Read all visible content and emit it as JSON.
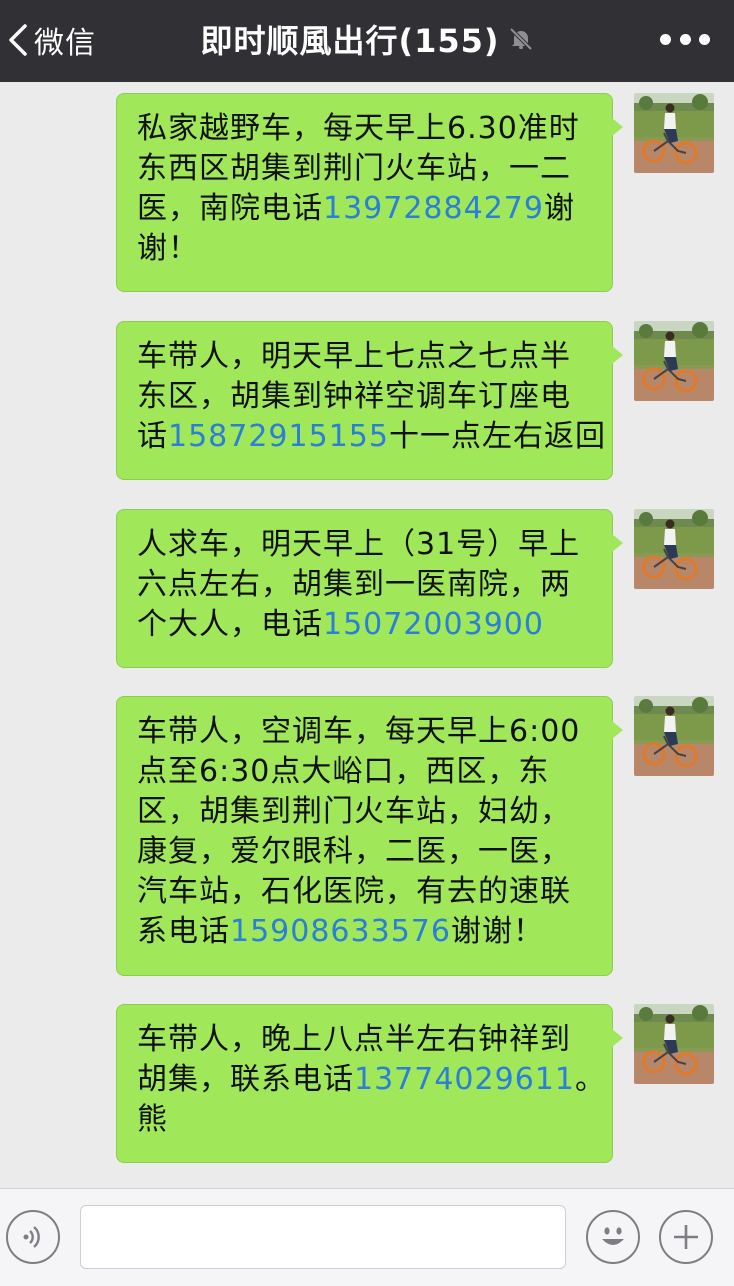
{
  "header": {
    "back_label": "微信",
    "title": "即时顺風出行(155)",
    "mute_icon": "bell-slash-icon",
    "more_icon": "more-dots-icon"
  },
  "messages": [
    {
      "lines": [
        [
          {
            "text": "私家越野车，每天早上6.30准时"
          }
        ],
        [
          {
            "text": "东西区胡集到荆门火车站，一二"
          }
        ],
        [
          {
            "text": "医，南院电话"
          },
          {
            "text": "13972884279",
            "phone": true
          },
          {
            "text": "谢"
          }
        ],
        [
          {
            "text": "谢！"
          }
        ]
      ]
    },
    {
      "lines": [
        [
          {
            "text": "车带人，明天早上七点之七点半"
          }
        ],
        [
          {
            "text": "东区，胡集到钟祥空调车订座电"
          }
        ],
        [
          {
            "text": "话"
          },
          {
            "text": "15872915155",
            "phone": true
          },
          {
            "text": "十一点左右返回"
          }
        ]
      ]
    },
    {
      "lines": [
        [
          {
            "text": "人求车，明天早上（31号）早上"
          }
        ],
        [
          {
            "text": "六点左右，胡集到一医南院，两"
          }
        ],
        [
          {
            "text": "个大人，电话"
          },
          {
            "text": "15072003900",
            "phone": true
          }
        ]
      ]
    },
    {
      "lines": [
        [
          {
            "text": "车带人，空调车，每天早上6:00"
          }
        ],
        [
          {
            "text": "点至6:30点大峪口，西区，东"
          }
        ],
        [
          {
            "text": "区，胡集到荆门火车站，妇幼，"
          }
        ],
        [
          {
            "text": "康复，爱尔眼科，二医，一医，"
          }
        ],
        [
          {
            "text": "汽车站，石化医院，有去的速联"
          }
        ],
        [
          {
            "text": "系电话"
          },
          {
            "text": "15908633576",
            "phone": true
          },
          {
            "text": "谢谢！"
          }
        ]
      ]
    },
    {
      "lines": [
        [
          {
            "text": "车带人，晚上八点半左右钟祥到"
          }
        ],
        [
          {
            "text": "胡集，联系电话"
          },
          {
            "text": "13774029611",
            "phone": true
          },
          {
            "text": "。"
          }
        ],
        [
          {
            "text": "熊"
          }
        ]
      ]
    }
  ],
  "bottom_bar": {
    "voice_icon": "voice-icon",
    "emoji_icon": "emoji-icon",
    "plus_icon": "plus-icon"
  },
  "colors": {
    "header_bg": "#313135",
    "bubble_bg": "#a0e75a",
    "phone_link": "#2a7fd6",
    "chat_bg": "#ebebeb"
  }
}
